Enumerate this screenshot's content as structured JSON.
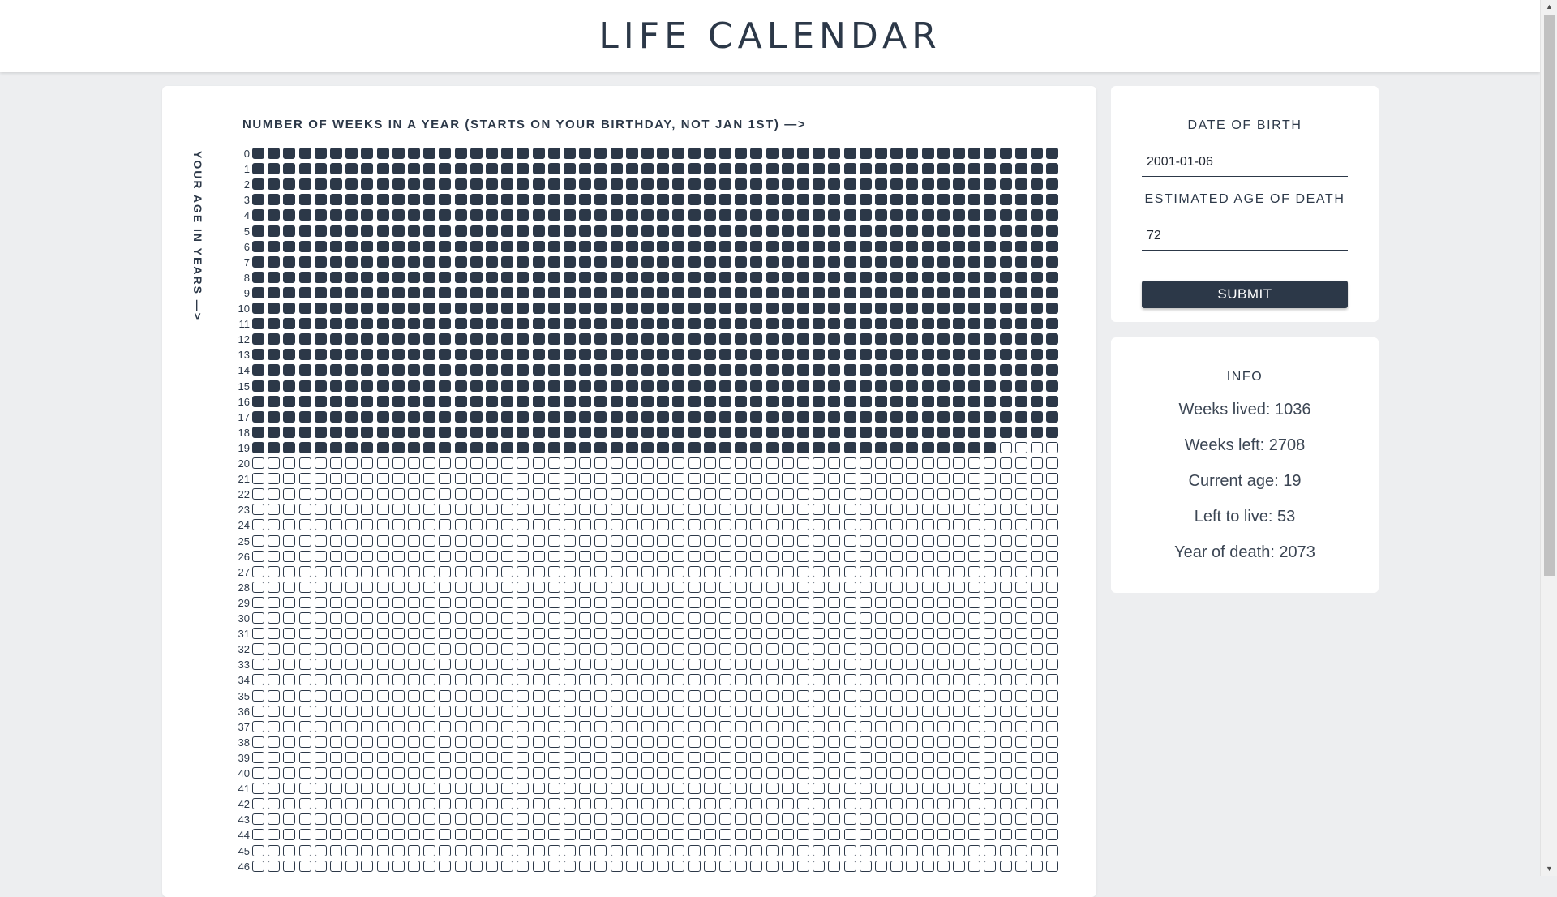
{
  "header": {
    "title": "LIFE CALENDAR"
  },
  "calendar": {
    "weeks_axis_label": "NUMBER OF WEEKS IN A YEAR (STARTS ON YOUR BIRTHDAY, NOT JAN 1ST) —>",
    "age_axis_label": "YOUR AGE IN YEARS —>",
    "weeks_per_year": 52,
    "visible_years": 47,
    "weeks_lived": 1036
  },
  "form": {
    "dob_label": "DATE OF BIRTH",
    "dob_value": "2001-01-06",
    "death_age_label": "ESTIMATED AGE OF DEATH",
    "death_age_value": "72",
    "submit_label": "SUBMIT"
  },
  "info": {
    "title": "INFO",
    "weeks_lived": "Weeks lived: 1036",
    "weeks_left": "Weeks left: 2708",
    "current_age": "Current age: 19",
    "left_to_live": "Left to live: 53",
    "year_of_death": "Year of death: 2073"
  },
  "colors": {
    "primary": "#2c3848",
    "background": "#edeef0",
    "card": "#ffffff"
  }
}
